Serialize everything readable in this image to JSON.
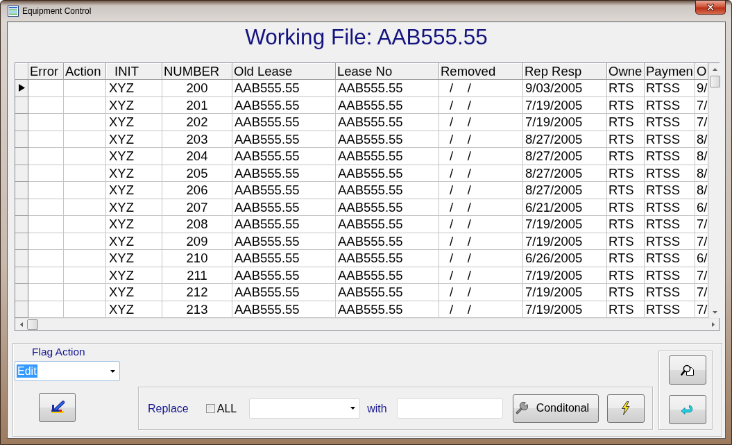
{
  "window": {
    "title": "Equipment Control"
  },
  "heading": "Working File: AAB555.55",
  "table": {
    "columns": [
      "Error",
      "Action",
      "INIT",
      "NUMBER",
      "Old Lease",
      "Lease No",
      "Removed",
      "Rep Resp",
      "Owne",
      "Paymen",
      "O"
    ],
    "rows": [
      {
        "selected": true,
        "cells": [
          "",
          "",
          "XYZ",
          "200",
          "AAB555.55",
          "AAB555.55",
          "/    /",
          "9/03/2005",
          "RTS",
          "RTSS",
          "9/"
        ]
      },
      {
        "selected": false,
        "cells": [
          "",
          "",
          "XYZ",
          "201",
          "AAB555.55",
          "AAB555.55",
          "/    /",
          "7/19/2005",
          "RTS",
          "RTSS",
          "7/"
        ]
      },
      {
        "selected": false,
        "cells": [
          "",
          "",
          "XYZ",
          "202",
          "AAB555.55",
          "AAB555.55",
          "/    /",
          "7/19/2005",
          "RTS",
          "RTSS",
          "7/"
        ]
      },
      {
        "selected": false,
        "cells": [
          "",
          "",
          "XYZ",
          "203",
          "AAB555.55",
          "AAB555.55",
          "/    /",
          "8/27/2005",
          "RTS",
          "RTSS",
          "8/"
        ]
      },
      {
        "selected": false,
        "cells": [
          "",
          "",
          "XYZ",
          "204",
          "AAB555.55",
          "AAB555.55",
          "/    /",
          "8/27/2005",
          "RTS",
          "RTSS",
          "8/"
        ]
      },
      {
        "selected": false,
        "cells": [
          "",
          "",
          "XYZ",
          "205",
          "AAB555.55",
          "AAB555.55",
          "/    /",
          "8/27/2005",
          "RTS",
          "RTSS",
          "8/"
        ]
      },
      {
        "selected": false,
        "cells": [
          "",
          "",
          "XYZ",
          "206",
          "AAB555.55",
          "AAB555.55",
          "/    /",
          "8/27/2005",
          "RTS",
          "RTSS",
          "8/"
        ]
      },
      {
        "selected": false,
        "cells": [
          "",
          "",
          "XYZ",
          "207",
          "AAB555.55",
          "AAB555.55",
          "/    /",
          "6/21/2005",
          "RTS",
          "RTSS",
          "6/"
        ]
      },
      {
        "selected": false,
        "cells": [
          "",
          "",
          "XYZ",
          "208",
          "AAB555.55",
          "AAB555.55",
          "/    /",
          "7/19/2005",
          "RTS",
          "RTSS",
          "7/"
        ]
      },
      {
        "selected": false,
        "cells": [
          "",
          "",
          "XYZ",
          "209",
          "AAB555.55",
          "AAB555.55",
          "/    /",
          "7/19/2005",
          "RTS",
          "RTSS",
          "7/"
        ]
      },
      {
        "selected": false,
        "cells": [
          "",
          "",
          "XYZ",
          "210",
          "AAB555.55",
          "AAB555.55",
          "/    /",
          "6/26/2005",
          "RTS",
          "RTSS",
          "6/"
        ]
      },
      {
        "selected": false,
        "cells": [
          "",
          "",
          "XYZ",
          "211",
          "AAB555.55",
          "AAB555.55",
          "/    /",
          "7/19/2005",
          "RTS",
          "RTSS",
          "7/"
        ]
      },
      {
        "selected": false,
        "cells": [
          "",
          "",
          "XYZ",
          "212",
          "AAB555.55",
          "AAB555.55",
          "/    /",
          "7/19/2005",
          "RTS",
          "RTSS",
          "7/"
        ]
      },
      {
        "selected": false,
        "cells": [
          "",
          "",
          "XYZ",
          "213",
          "AAB555.55",
          "AAB555.55",
          "/    /",
          "7/19/2005",
          "RTS",
          "RTSS",
          "7/"
        ]
      }
    ]
  },
  "flag_action": {
    "label": "Flag Action",
    "value": "Edit",
    "focused": true
  },
  "replace": {
    "label": "Replace",
    "all": {
      "label": "ALL",
      "checked": false
    },
    "with_label": "with",
    "conditional_button": "Conditonal"
  }
}
